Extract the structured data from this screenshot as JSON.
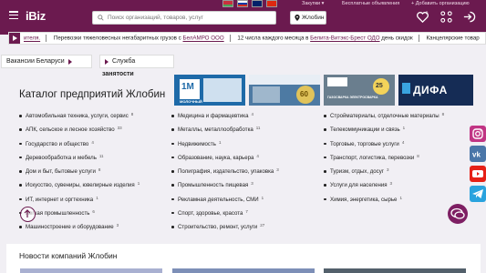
{
  "header": {
    "logo": "iBiz",
    "search_placeholder": "Поиск организаций, товаров, услуг",
    "city": "Жлобин",
    "links": {
      "purchases": "Закупки",
      "free_ads": "Бесплатные объявления",
      "add_company": "+ Добавить организацию"
    }
  },
  "ticker": {
    "lead": "ителя.",
    "items": [
      {
        "text": "Перевозки тяжеловесных негабаритных грузов с ",
        "link": "БелАМРО ООО"
      },
      {
        "text": "12 числа каждого месяца в ",
        "link": "Белита-Витэкс-Брест ОДО",
        "after": " день скидок"
      },
      {
        "text": "Канцелярские товар"
      }
    ]
  },
  "chips": {
    "vacancies": "Вакансии Беларуси",
    "services": "Служба",
    "services_sub": "занятости"
  },
  "page_title": "Каталог предприятий Жлобин",
  "banners": [
    "1M МОЛОЧНЫЙ",
    "ДЕНЬ ГОРОДА",
    "ГАЗОСВАРКА ЭЛЕКТРОСВАРКА",
    "ДИФА"
  ],
  "catalog": {
    "col1": [
      {
        "label": "Автомобильная техника, услуги, сервис",
        "count": "8"
      },
      {
        "label": "АПК, сельское и лесное хозяйство",
        "count": "33"
      },
      {
        "label": "Государство и общество",
        "count": "4"
      },
      {
        "label": "Деревообработка и мебель",
        "count": "11"
      },
      {
        "label": "Дом и быт, бытовые услуги",
        "count": "8"
      },
      {
        "label": "Искусство, сувениры, ювелирные изделия",
        "count": "1"
      },
      {
        "label": "ИТ, интернет и оргтехника",
        "count": "1"
      },
      {
        "label": "Легкая промышленность",
        "count": "6"
      },
      {
        "label": "Машиностроение и оборудование",
        "count": "3"
      }
    ],
    "col2": [
      {
        "label": "Медицина и фармацевтика",
        "count": "4"
      },
      {
        "label": "Металлы, металлообработка",
        "count": "11"
      },
      {
        "label": "Недвижимость",
        "count": "1"
      },
      {
        "label": "Образование, наука, карьера",
        "count": "4"
      },
      {
        "label": "Полиграфия, издательство, упаковка",
        "count": "3"
      },
      {
        "label": "Промышленность пищевая",
        "count": "3"
      },
      {
        "label": "Рекламная деятельность, СМИ",
        "count": "1"
      },
      {
        "label": "Спорт, здоровье, красота",
        "count": "7"
      },
      {
        "label": "Строительство, ремонт, услуги",
        "count": "27"
      }
    ],
    "col3": [
      {
        "label": "Стройматериалы, отделочные материалы",
        "count": "8"
      },
      {
        "label": "Телекоммуникации и связь",
        "count": "1"
      },
      {
        "label": "Торговые, торговые услуги",
        "count": "4"
      },
      {
        "label": "Транспорт, логистика, перевозки",
        "count": "8"
      },
      {
        "label": "Туризм, отдых, досуг",
        "count": "3"
      },
      {
        "label": "Услуги для населения",
        "count": "3"
      },
      {
        "label": "Химия, энергетика, сырье",
        "count": "1"
      }
    ]
  },
  "news": {
    "title": "Новости компаний Жлобин"
  },
  "social": [
    {
      "name": "instagram",
      "color": "#c13584"
    },
    {
      "name": "vk",
      "color": "#4a76a8"
    },
    {
      "name": "youtube",
      "color": "#e62117"
    },
    {
      "name": "telegram",
      "color": "#2aa3de"
    }
  ],
  "colors": {
    "brand": "#6b1a4f"
  }
}
